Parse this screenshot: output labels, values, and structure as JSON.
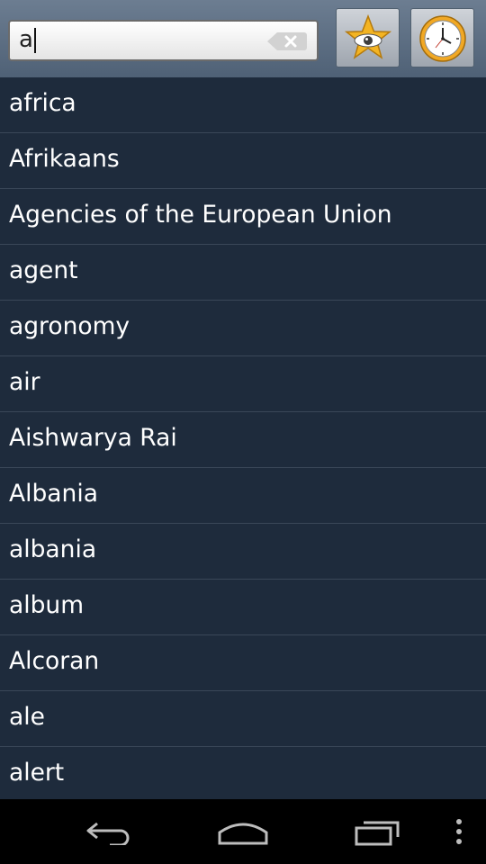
{
  "search": {
    "value": "a"
  },
  "toolbar": {
    "favorites_icon": "star-eye-icon",
    "history_icon": "clock-icon"
  },
  "results": [
    "africa",
    "Afrikaans",
    "Agencies of the European Union",
    "agent",
    "agronomy",
    "air",
    "Aishwarya Rai",
    "Albania",
    "albania",
    "album",
    "Alcoran",
    "ale",
    "alert"
  ],
  "navbar": {
    "back_icon": "back-icon",
    "home_icon": "home-icon",
    "recents_icon": "recent-apps-icon",
    "menu_icon": "overflow-menu-icon"
  }
}
